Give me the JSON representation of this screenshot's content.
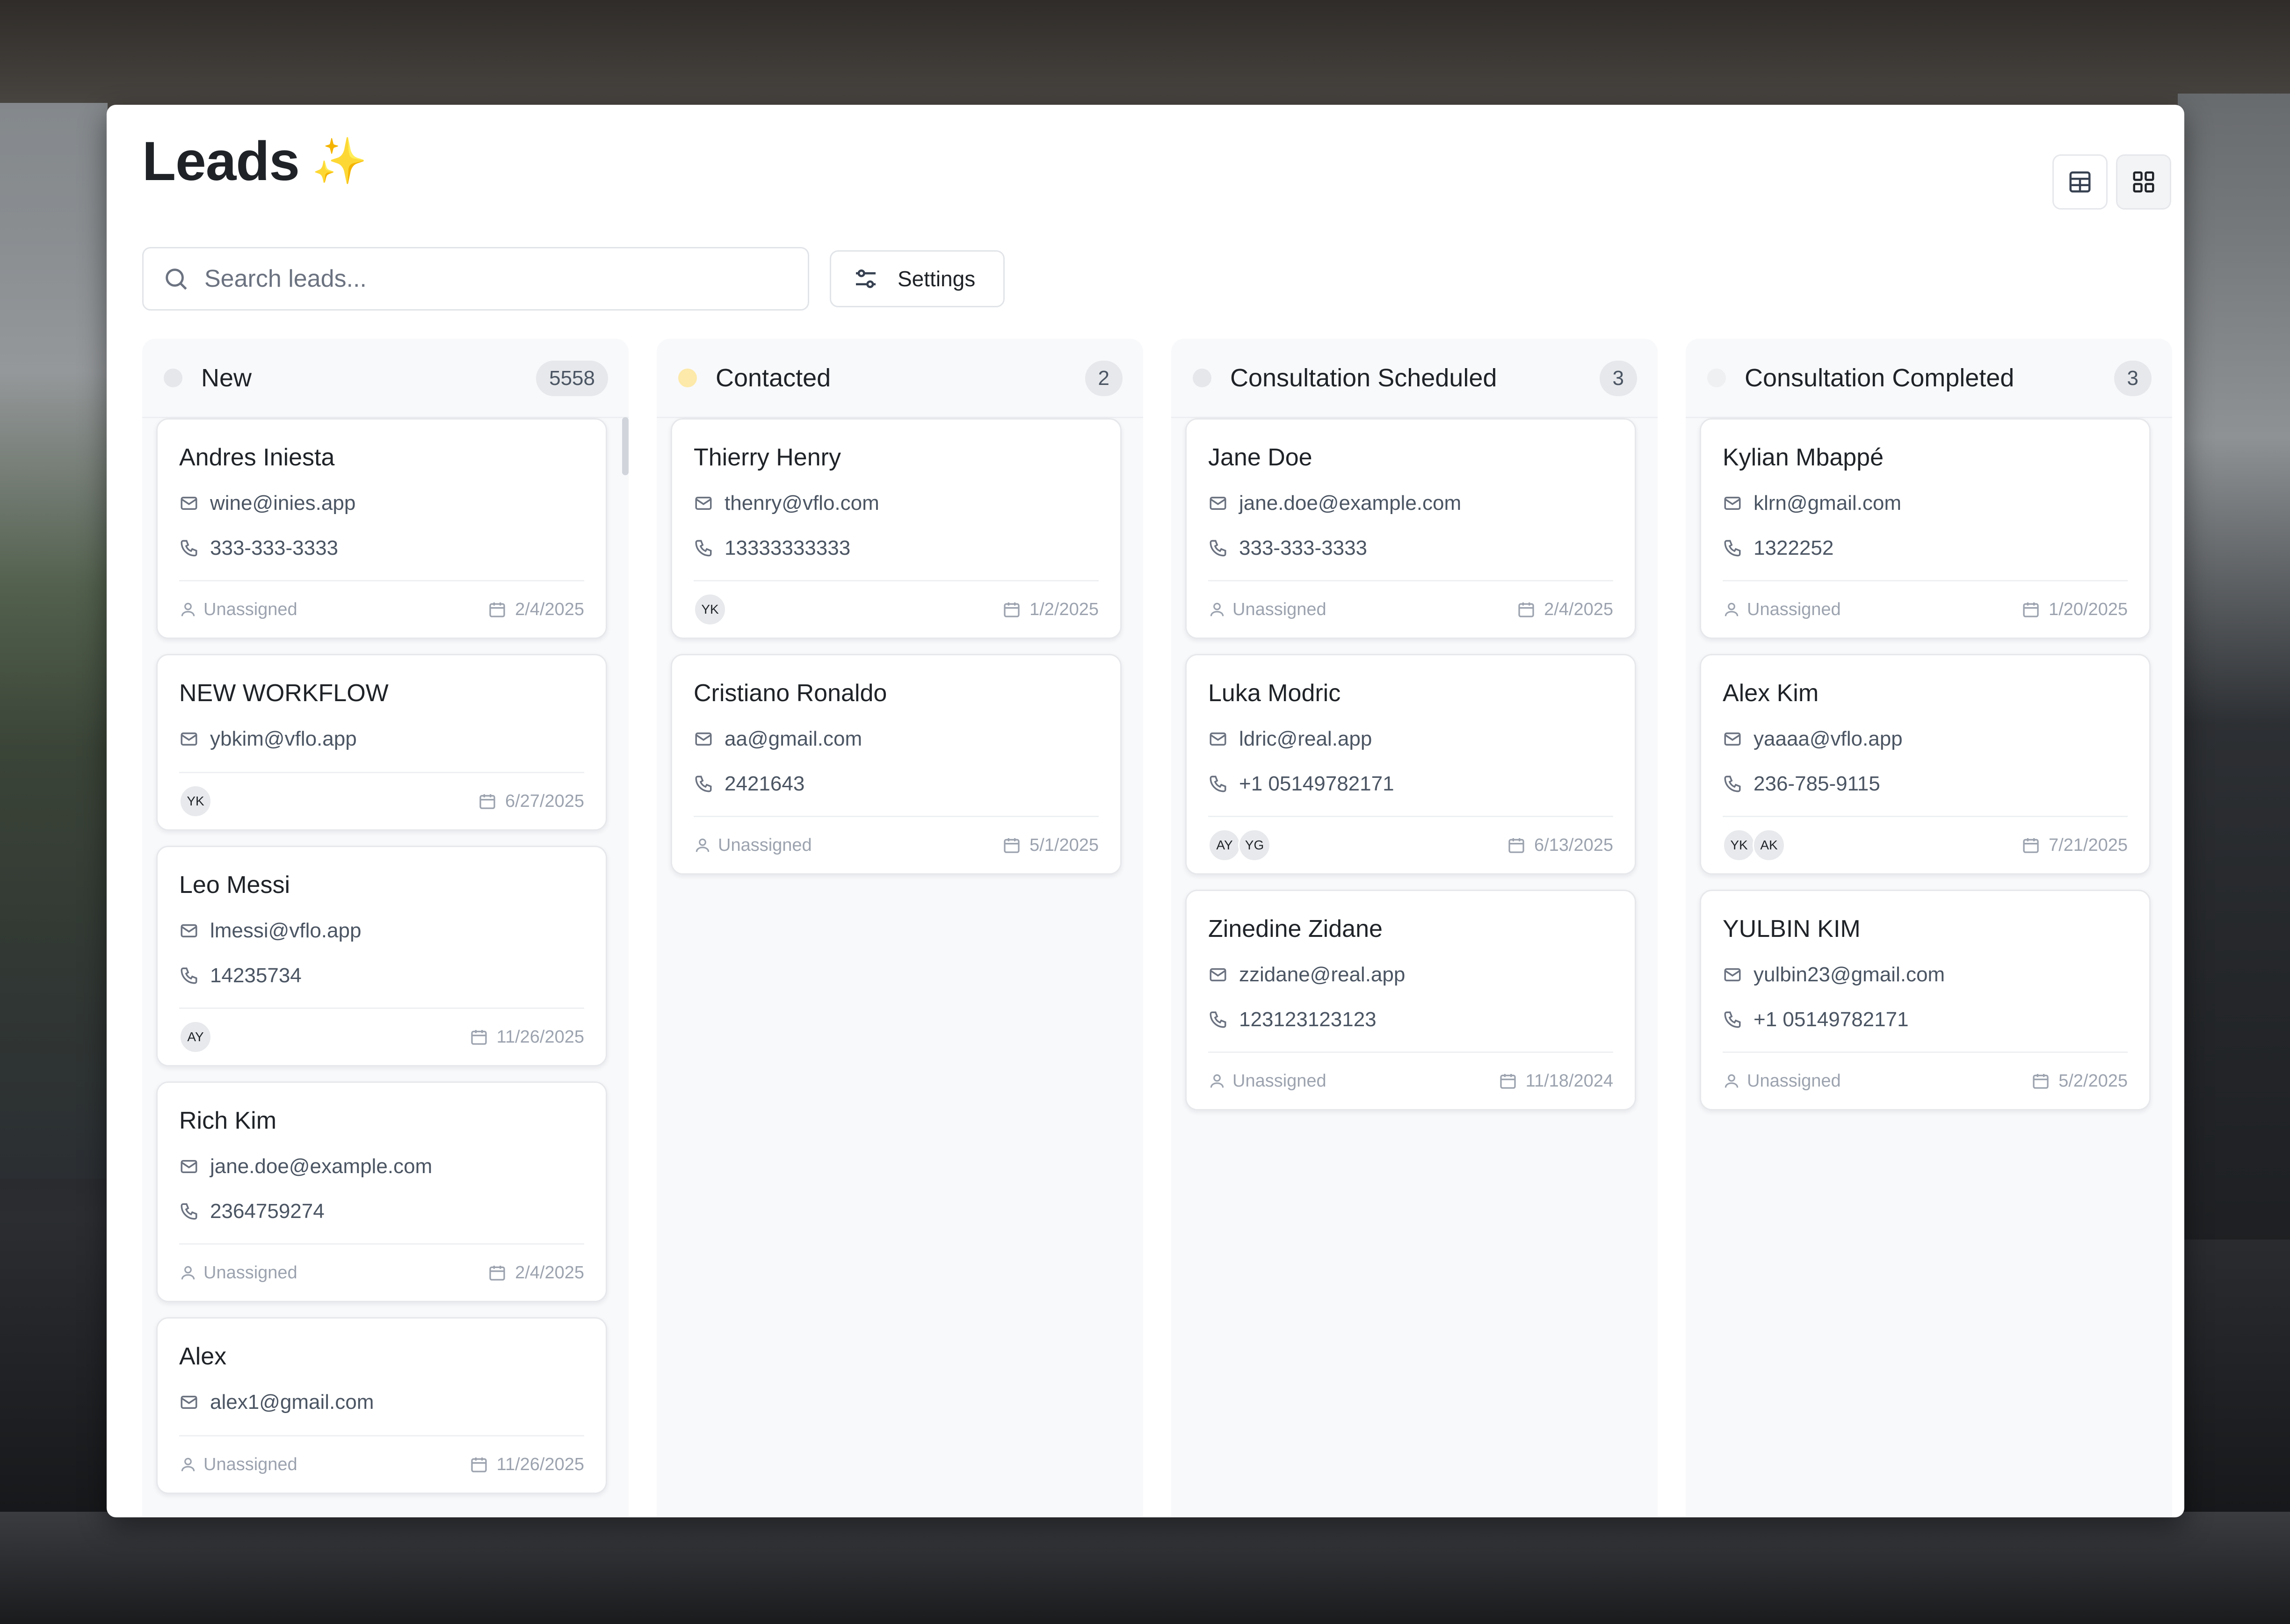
{
  "page": {
    "title": "Leads",
    "title_icon": "✨"
  },
  "view_toggle": {
    "icons": [
      "table-view-icon",
      "grid-view-icon"
    ],
    "active": "grid"
  },
  "search": {
    "placeholder": "Search leads...",
    "value": ""
  },
  "settings": {
    "label": "Settings"
  },
  "colors": {
    "new": "#e5e7eb",
    "contacted": "#fde9a9",
    "scheduled": "#e5e7eb",
    "completed": "#eef0f2"
  },
  "columns": [
    {
      "title": "New",
      "count": "5558",
      "cards": [
        {
          "name": "Andres Iniesta",
          "email": "wine@inies.app",
          "phone": "333-333-3333",
          "assignee": "Unassigned",
          "avatars": [],
          "date": "2/4/2025"
        },
        {
          "name": "NEW WORKFLOW",
          "email": "ybkim@vflo.app",
          "phone": "",
          "assignee": "",
          "avatars": [
            "YK"
          ],
          "date": "6/27/2025"
        },
        {
          "name": "Leo Messi",
          "email": "lmessi@vflo.app",
          "phone": "14235734",
          "assignee": "",
          "avatars": [
            "AY"
          ],
          "date": "11/26/2025"
        },
        {
          "name": "Rich Kim",
          "email": "jane.doe@example.com",
          "phone": "2364759274",
          "assignee": "Unassigned",
          "avatars": [],
          "date": "2/4/2025"
        },
        {
          "name": "Alex",
          "email": "alex1@gmail.com",
          "phone": "",
          "assignee": "Unassigned",
          "avatars": [],
          "date": "11/26/2025"
        }
      ]
    },
    {
      "title": "Contacted",
      "count": "2",
      "cards": [
        {
          "name": "Thierry Henry",
          "email": "thenry@vflo.com",
          "phone": "13333333333",
          "assignee": "",
          "avatars": [
            "YK"
          ],
          "date": "1/2/2025"
        },
        {
          "name": "Cristiano Ronaldo",
          "email": "aa@gmail.com",
          "phone": "2421643",
          "assignee": "Unassigned",
          "avatars": [],
          "date": "5/1/2025"
        }
      ]
    },
    {
      "title": "Consultation Scheduled",
      "count": "3",
      "cards": [
        {
          "name": "Jane Doe",
          "email": "jane.doe@example.com",
          "phone": "333-333-3333",
          "assignee": "Unassigned",
          "avatars": [],
          "date": "2/4/2025"
        },
        {
          "name": "Luka Modric",
          "email": "ldric@real.app",
          "phone": "+1 05149782171",
          "assignee": "",
          "avatars": [
            "AY",
            "YG"
          ],
          "date": "6/13/2025"
        },
        {
          "name": "Zinedine Zidane",
          "email": "zzidane@real.app",
          "phone": "123123123123",
          "assignee": "Unassigned",
          "avatars": [],
          "date": "11/18/2024"
        }
      ]
    },
    {
      "title": "Consultation Completed",
      "count": "3",
      "cards": [
        {
          "name": "Kylian Mbappé",
          "email": "klrn@gmail.com",
          "phone": "1322252",
          "assignee": "Unassigned",
          "avatars": [],
          "date": "1/20/2025"
        },
        {
          "name": "Alex Kim",
          "email": "yaaaa@vflo.app",
          "phone": "236-785-9115",
          "assignee": "",
          "avatars": [
            "YK",
            "AK"
          ],
          "date": "7/21/2025"
        },
        {
          "name": "YULBIN KIM",
          "email": "yulbin23@gmail.com",
          "phone": "+1 05149782171",
          "assignee": "Unassigned",
          "avatars": [],
          "date": "5/2/2025"
        }
      ]
    }
  ]
}
